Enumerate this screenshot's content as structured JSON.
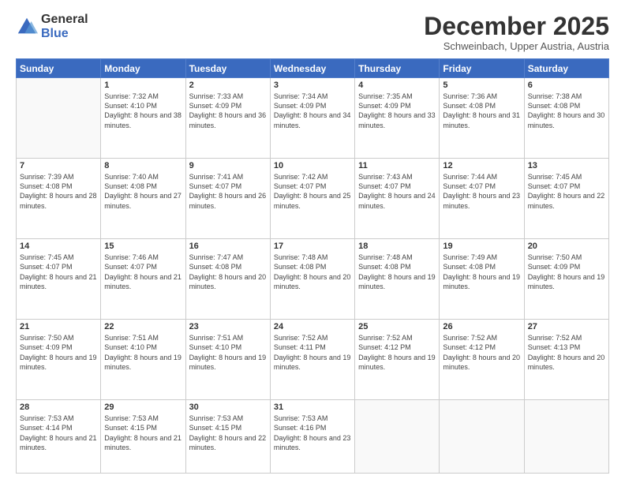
{
  "logo": {
    "general": "General",
    "blue": "Blue"
  },
  "header": {
    "month": "December 2025",
    "location": "Schweinbach, Upper Austria, Austria"
  },
  "days": [
    "Sunday",
    "Monday",
    "Tuesday",
    "Wednesday",
    "Thursday",
    "Friday",
    "Saturday"
  ],
  "weeks": [
    [
      {
        "num": "",
        "empty": true
      },
      {
        "num": "1",
        "sunrise": "7:32 AM",
        "sunset": "4:10 PM",
        "daylight": "8 hours and 38 minutes."
      },
      {
        "num": "2",
        "sunrise": "7:33 AM",
        "sunset": "4:09 PM",
        "daylight": "8 hours and 36 minutes."
      },
      {
        "num": "3",
        "sunrise": "7:34 AM",
        "sunset": "4:09 PM",
        "daylight": "8 hours and 34 minutes."
      },
      {
        "num": "4",
        "sunrise": "7:35 AM",
        "sunset": "4:09 PM",
        "daylight": "8 hours and 33 minutes."
      },
      {
        "num": "5",
        "sunrise": "7:36 AM",
        "sunset": "4:08 PM",
        "daylight": "8 hours and 31 minutes."
      },
      {
        "num": "6",
        "sunrise": "7:38 AM",
        "sunset": "4:08 PM",
        "daylight": "8 hours and 30 minutes."
      }
    ],
    [
      {
        "num": "7",
        "sunrise": "7:39 AM",
        "sunset": "4:08 PM",
        "daylight": "8 hours and 28 minutes."
      },
      {
        "num": "8",
        "sunrise": "7:40 AM",
        "sunset": "4:08 PM",
        "daylight": "8 hours and 27 minutes."
      },
      {
        "num": "9",
        "sunrise": "7:41 AM",
        "sunset": "4:07 PM",
        "daylight": "8 hours and 26 minutes."
      },
      {
        "num": "10",
        "sunrise": "7:42 AM",
        "sunset": "4:07 PM",
        "daylight": "8 hours and 25 minutes."
      },
      {
        "num": "11",
        "sunrise": "7:43 AM",
        "sunset": "4:07 PM",
        "daylight": "8 hours and 24 minutes."
      },
      {
        "num": "12",
        "sunrise": "7:44 AM",
        "sunset": "4:07 PM",
        "daylight": "8 hours and 23 minutes."
      },
      {
        "num": "13",
        "sunrise": "7:45 AM",
        "sunset": "4:07 PM",
        "daylight": "8 hours and 22 minutes."
      }
    ],
    [
      {
        "num": "14",
        "sunrise": "7:45 AM",
        "sunset": "4:07 PM",
        "daylight": "8 hours and 21 minutes."
      },
      {
        "num": "15",
        "sunrise": "7:46 AM",
        "sunset": "4:07 PM",
        "daylight": "8 hours and 21 minutes."
      },
      {
        "num": "16",
        "sunrise": "7:47 AM",
        "sunset": "4:08 PM",
        "daylight": "8 hours and 20 minutes."
      },
      {
        "num": "17",
        "sunrise": "7:48 AM",
        "sunset": "4:08 PM",
        "daylight": "8 hours and 20 minutes."
      },
      {
        "num": "18",
        "sunrise": "7:48 AM",
        "sunset": "4:08 PM",
        "daylight": "8 hours and 19 minutes."
      },
      {
        "num": "19",
        "sunrise": "7:49 AM",
        "sunset": "4:08 PM",
        "daylight": "8 hours and 19 minutes."
      },
      {
        "num": "20",
        "sunrise": "7:50 AM",
        "sunset": "4:09 PM",
        "daylight": "8 hours and 19 minutes."
      }
    ],
    [
      {
        "num": "21",
        "sunrise": "7:50 AM",
        "sunset": "4:09 PM",
        "daylight": "8 hours and 19 minutes."
      },
      {
        "num": "22",
        "sunrise": "7:51 AM",
        "sunset": "4:10 PM",
        "daylight": "8 hours and 19 minutes."
      },
      {
        "num": "23",
        "sunrise": "7:51 AM",
        "sunset": "4:10 PM",
        "daylight": "8 hours and 19 minutes."
      },
      {
        "num": "24",
        "sunrise": "7:52 AM",
        "sunset": "4:11 PM",
        "daylight": "8 hours and 19 minutes."
      },
      {
        "num": "25",
        "sunrise": "7:52 AM",
        "sunset": "4:12 PM",
        "daylight": "8 hours and 19 minutes."
      },
      {
        "num": "26",
        "sunrise": "7:52 AM",
        "sunset": "4:12 PM",
        "daylight": "8 hours and 20 minutes."
      },
      {
        "num": "27",
        "sunrise": "7:52 AM",
        "sunset": "4:13 PM",
        "daylight": "8 hours and 20 minutes."
      }
    ],
    [
      {
        "num": "28",
        "sunrise": "7:53 AM",
        "sunset": "4:14 PM",
        "daylight": "8 hours and 21 minutes."
      },
      {
        "num": "29",
        "sunrise": "7:53 AM",
        "sunset": "4:15 PM",
        "daylight": "8 hours and 21 minutes."
      },
      {
        "num": "30",
        "sunrise": "7:53 AM",
        "sunset": "4:15 PM",
        "daylight": "8 hours and 22 minutes."
      },
      {
        "num": "31",
        "sunrise": "7:53 AM",
        "sunset": "4:16 PM",
        "daylight": "8 hours and 23 minutes."
      },
      {
        "num": "",
        "empty": true
      },
      {
        "num": "",
        "empty": true
      },
      {
        "num": "",
        "empty": true
      }
    ]
  ]
}
